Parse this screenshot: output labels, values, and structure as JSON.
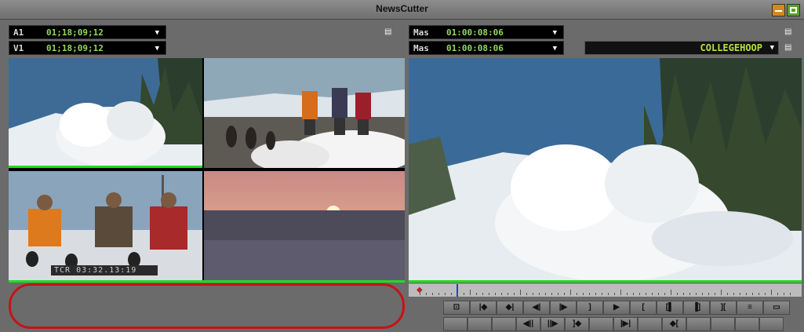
{
  "window": {
    "title": "NewsCutter"
  },
  "source_monitor": {
    "tracks": [
      {
        "track": "A1",
        "timecode": "01;18;09;12"
      },
      {
        "track": "V1",
        "timecode": "01;18;09;12"
      }
    ],
    "burnin_timecode": "TCR 03:32.13:19"
  },
  "record_monitor": {
    "tracks": [
      {
        "track": "Mas",
        "timecode": "01:00:08:06"
      },
      {
        "track": "Mas",
        "timecode": "01:00:08:06"
      }
    ],
    "bin_selector": "COLLEGEHOOP"
  },
  "icons": {
    "dropdown": "▼",
    "menu": "▤",
    "minimize": "minimize-icon",
    "maximize": "maximize-icon"
  },
  "colors": {
    "timecode": "#8fd95a",
    "bin_text": "#b8e040",
    "green_bar": "#1fdc1f",
    "annotation_ring": "#c41414"
  },
  "controls": {
    "row1": [
      "⊡",
      "|◆",
      "◆|",
      "◀|",
      "|▶",
      "]",
      "▶",
      "[",
      "[▌",
      "▐]",
      "][",
      "≡",
      "▭"
    ],
    "row2": [
      "",
      "",
      "",
      "◀||",
      "||▶",
      "]◆",
      "",
      "|▶|",
      "",
      "◆[",
      "",
      "",
      "",
      ""
    ]
  }
}
